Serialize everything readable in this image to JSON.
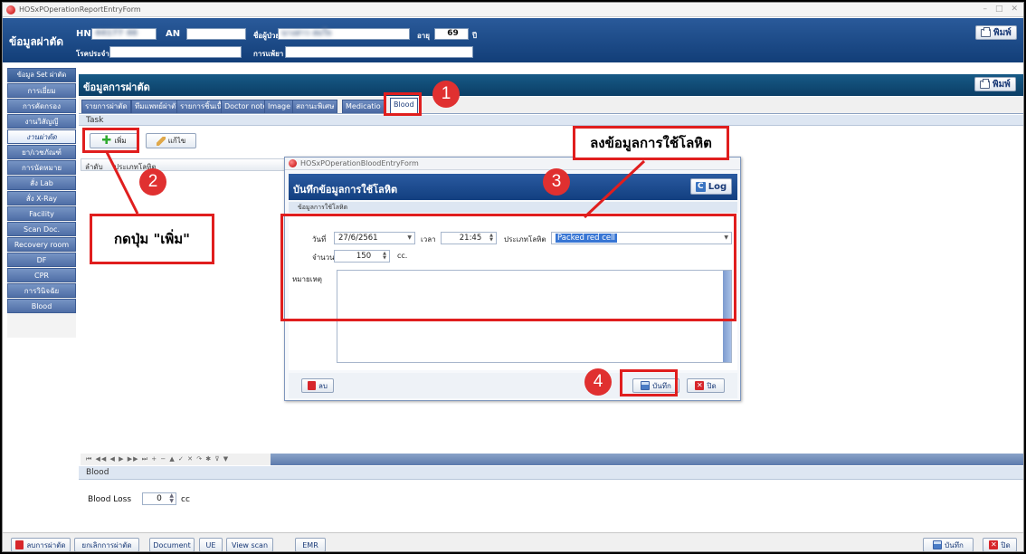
{
  "window": {
    "title": "HOSxPOperationReportEntryForm",
    "controls": [
      "–",
      "□",
      "✕"
    ]
  },
  "patient_header": {
    "title": "ข้อมูลผ่าตัด",
    "hn_label": "HN",
    "hn_value": "44177 46",
    "an_label": "AN",
    "an_value": "",
    "name_label": "ชื่อผู้ป่วย",
    "name_value": "นางสาว สมใจ",
    "age_label": "อายุ",
    "age_value": "69",
    "age_unit": "ปี",
    "disease_label": "โรคประจำตัว",
    "disease_value": "",
    "allergy_label": "การแพ้ยา",
    "allergy_value": "",
    "print_label": "พิมพ์"
  },
  "sidebar": {
    "items": [
      {
        "label": "ข้อมูล Set ผ่าตัด"
      },
      {
        "label": "การเยี่ยม"
      },
      {
        "label": "การคัดกรอง"
      },
      {
        "label": "งานวิสัญญี"
      },
      {
        "label": "งานผ่าตัด"
      },
      {
        "label": "ยา/เวชภัณฑ์"
      },
      {
        "label": "การนัดหมาย"
      },
      {
        "label": "สั่ง Lab"
      },
      {
        "label": "สั่ง X-Ray"
      },
      {
        "label": "Facility"
      },
      {
        "label": "Scan Doc."
      },
      {
        "label": "Recovery room"
      },
      {
        "label": "DF"
      },
      {
        "label": "CPR"
      },
      {
        "label": "การวินิจฉัย"
      },
      {
        "label": "Blood"
      }
    ]
  },
  "main": {
    "title": "ข้อมูลการผ่าตัด",
    "print_label": "พิมพ์",
    "tabs": [
      {
        "label": "รายการผ่าตัด"
      },
      {
        "label": "ทีมแพทย์ผ่าตัด"
      },
      {
        "label": "รายการชิ้นเนื้อ"
      },
      {
        "label": "Doctor note"
      },
      {
        "label": "Image"
      },
      {
        "label": "สถานะพิเศษ"
      },
      {
        "label": "Medicatio"
      },
      {
        "label": "Blood"
      }
    ],
    "task_label": "Task",
    "add_label": "เพิ่ม",
    "edit_label": "แก้ไข",
    "grid_columns": [
      "ลำดับ",
      "ประเภทโลหิต"
    ],
    "navigator": "⏮ ◀◀ ◀ ▶ ▶▶ ⏭ + − ▲ ✓ ✕ ↷ ✱ ⊽ ▼",
    "blood_section": "Blood",
    "blood_loss_label": "Blood Loss",
    "blood_loss_value": "0",
    "blood_loss_unit": "cc"
  },
  "dialog": {
    "window_title": "HOSxPOperationBloodEntryForm",
    "title": "บันทึกข้อมูลการใช้โลหิต",
    "log_label": "Log",
    "section": "ข้อมูลการใช้โลหิต",
    "date_label": "วันที่",
    "date_value": "27/6/2561",
    "time_label": "เวลา",
    "time_value": "21:45",
    "type_label": "ประเภทโลหิต",
    "type_value": "Packed red cell",
    "amount_label": "จำนวน",
    "amount_value": "150",
    "amount_unit": "cc.",
    "note_label": "หมายเหตุ",
    "delete_label": "ลบ",
    "save_label": "บันทึก",
    "close_label": "ปิด"
  },
  "footer": {
    "delete_surgery": "ลบการผ่าตัด",
    "cancel_surgery": "ยกเลิกการผ่าตัด",
    "document": "Document",
    "ue": "UE",
    "view_scan": "View scan",
    "emr": "EMR",
    "save": "บันทึก",
    "close": "ปิด"
  },
  "annotations": {
    "step1": "1",
    "step2": "2",
    "step3": "3",
    "step4": "4",
    "callout_add": "กดปุ่ม \"เพิ่ม\"",
    "callout_blood": "ลงข้อมูลการใช้โลหิต"
  },
  "colors": {
    "accent": "#123e78",
    "annotation": "#e01e1e",
    "selection": "#3876d4"
  }
}
